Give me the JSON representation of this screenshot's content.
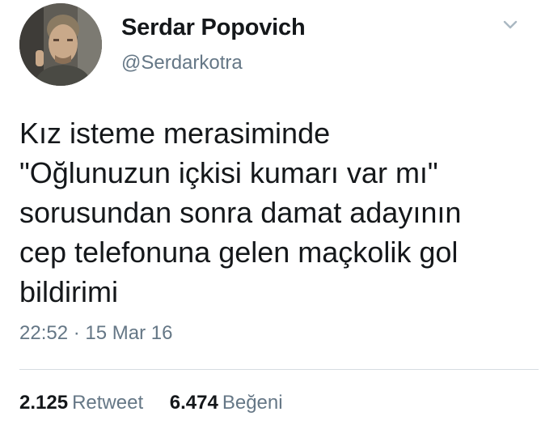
{
  "user": {
    "display_name": "Serdar Popovich",
    "handle": "@Serdarkotra"
  },
  "tweet": {
    "lines": [
      "Kız isteme merasiminde",
      "\"Oğlunuzun içkisi kumarı var mı\"",
      "sorusundan sonra damat adayının",
      "cep telefonuna gelen maçkolik gol",
      "bildirimi"
    ],
    "time": "22:52",
    "separator": "·",
    "date": "15 Mar 16"
  },
  "stats": {
    "retweets": {
      "count": "2.125",
      "label": "Retweet"
    },
    "likes": {
      "count": "6.474",
      "label": "Beğeni"
    }
  },
  "icons": {
    "caret": "chevron-down-icon"
  },
  "colors": {
    "text": "#14171a",
    "secondary": "#657786",
    "divider": "#d7dde2"
  }
}
